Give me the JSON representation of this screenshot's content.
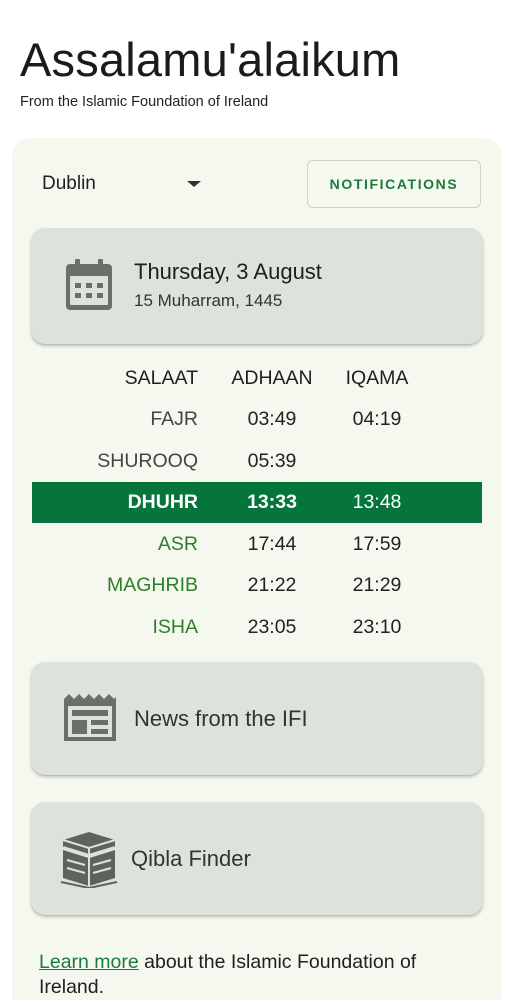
{
  "header": {
    "title": "Assalamu'alaikum",
    "subtitle": "From the Islamic Foundation of Ireland"
  },
  "location": {
    "city": "Dublin"
  },
  "notifications_label": "NOTIFICATIONS",
  "date_card": {
    "gregorian": "Thursday, 3 August",
    "hijri": "15 Muharram, 1445",
    "icon": "calendar-icon"
  },
  "table": {
    "headers": {
      "salaat": "SALAAT",
      "adhaan": "ADHAAN",
      "iqama": "IQAMA"
    },
    "rows": [
      {
        "name": "FAJR",
        "adhaan": "03:49",
        "iqama": "04:19",
        "state": "past"
      },
      {
        "name": "SHUROOQ",
        "adhaan": "05:39",
        "iqama": "",
        "state": "past"
      },
      {
        "name": "DHUHR",
        "adhaan": "13:33",
        "iqama": "13:48",
        "state": "current"
      },
      {
        "name": "ASR",
        "adhaan": "17:44",
        "iqama": "17:59",
        "state": "upcoming"
      },
      {
        "name": "MAGHRIB",
        "adhaan": "21:22",
        "iqama": "21:29",
        "state": "upcoming"
      },
      {
        "name": "ISHA",
        "adhaan": "23:05",
        "iqama": "23:10",
        "state": "upcoming"
      }
    ]
  },
  "news_card": {
    "label": "News from the IFI",
    "icon": "newspaper-icon"
  },
  "qibla_card": {
    "label": "Qibla Finder",
    "icon": "kaaba-icon"
  },
  "footer": {
    "link_text": "Learn more",
    "rest_text": " about the Islamic Foundation of Ireland."
  },
  "colors": {
    "accent_green": "#06753b",
    "upcoming_green": "#2f7d2a",
    "panel_bg": "#f5f8ee",
    "card_bg": "#dde3da"
  }
}
